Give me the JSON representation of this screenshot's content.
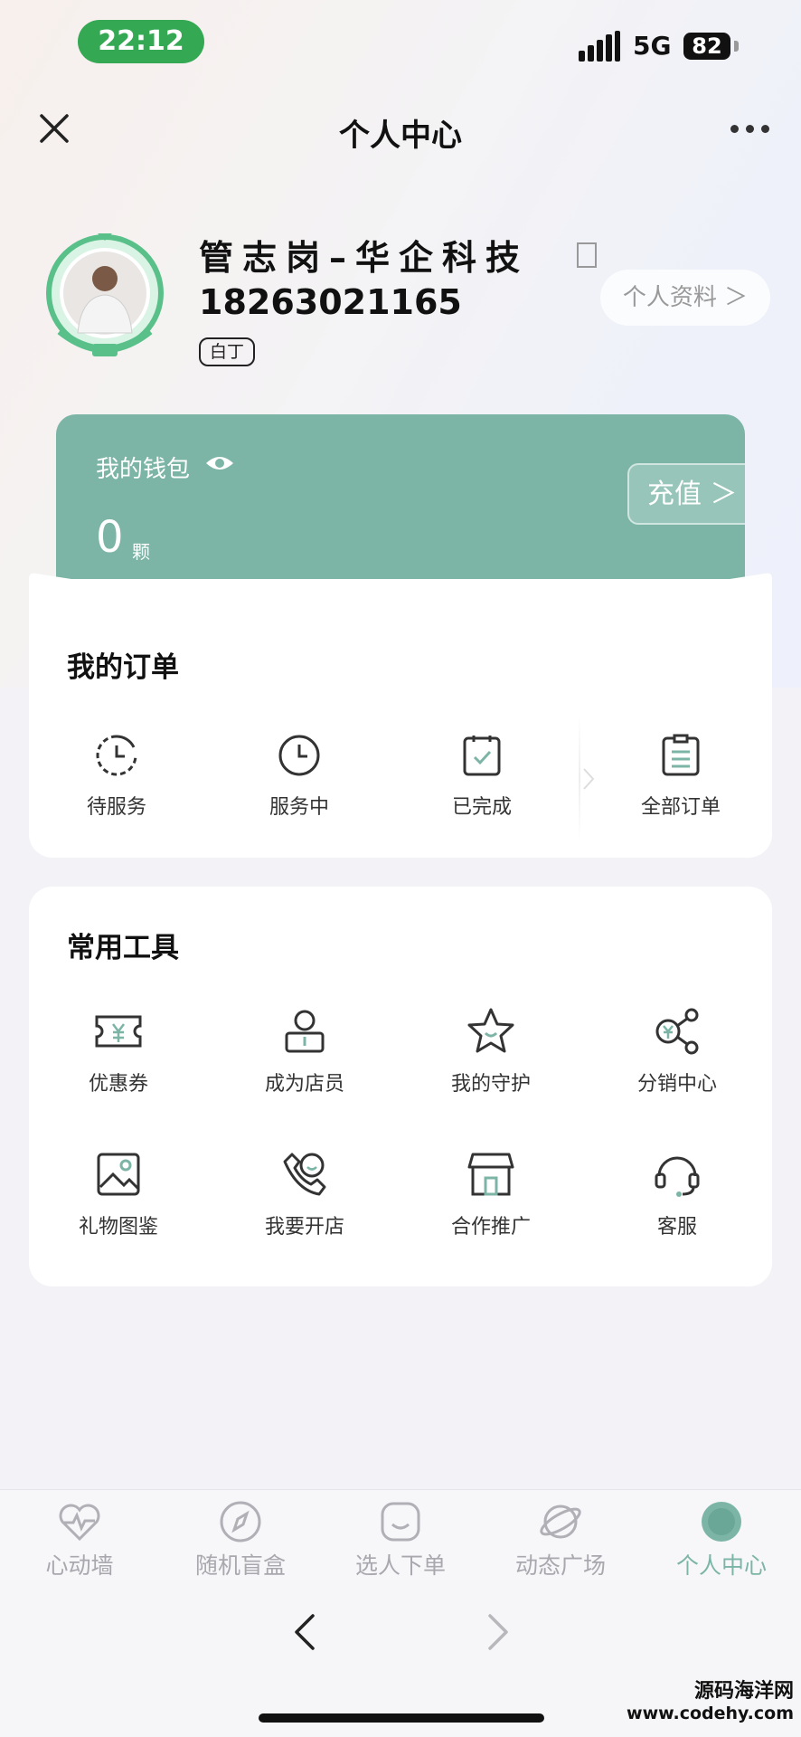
{
  "status_bar": {
    "time": "22:12",
    "network": "5G",
    "battery": "82"
  },
  "nav": {
    "title": "个人中心"
  },
  "profile": {
    "name": "管志岗–华企科技",
    "phone": "18263021165",
    "level": "白丁",
    "profile_button": "个人资料 ＞"
  },
  "wallet": {
    "title": "我的钱包",
    "value": "0",
    "unit": "颗",
    "recharge_label": "充值 ＞"
  },
  "orders": {
    "title": "我的订单",
    "items": [
      {
        "label": "待服务",
        "icon": "clock-refresh-icon"
      },
      {
        "label": "服务中",
        "icon": "clock-icon"
      },
      {
        "label": "已完成",
        "icon": "clipboard-check-icon"
      },
      {
        "label": "全部订单",
        "icon": "clipboard-list-icon"
      }
    ]
  },
  "tools": {
    "title": "常用工具",
    "items": [
      {
        "label": "优惠券",
        "icon": "coupon-icon"
      },
      {
        "label": "成为店员",
        "icon": "user-badge-icon"
      },
      {
        "label": "我的守护",
        "icon": "star-icon"
      },
      {
        "label": "分销中心",
        "icon": "share-yen-icon"
      },
      {
        "label": "礼物图鉴",
        "icon": "image-icon"
      },
      {
        "label": "我要开店",
        "icon": "phone-smile-icon"
      },
      {
        "label": "合作推广",
        "icon": "store-icon"
      },
      {
        "label": "客服",
        "icon": "headset-icon"
      }
    ]
  },
  "tab_bar": {
    "items": [
      {
        "label": "心动墙",
        "icon": "heart-pulse-icon"
      },
      {
        "label": "随机盲盒",
        "icon": "compass-icon"
      },
      {
        "label": "选人下单",
        "icon": "smile-box-icon"
      },
      {
        "label": "动态广场",
        "icon": "planet-icon"
      },
      {
        "label": "个人中心",
        "icon": "profile-circle-icon"
      }
    ],
    "active": "个人中心"
  },
  "watermark": {
    "line1": "源码海洋网",
    "line2": "www.codehy.com"
  },
  "colors": {
    "accent": "#7cb5a6",
    "time_pill": "#34a853"
  }
}
